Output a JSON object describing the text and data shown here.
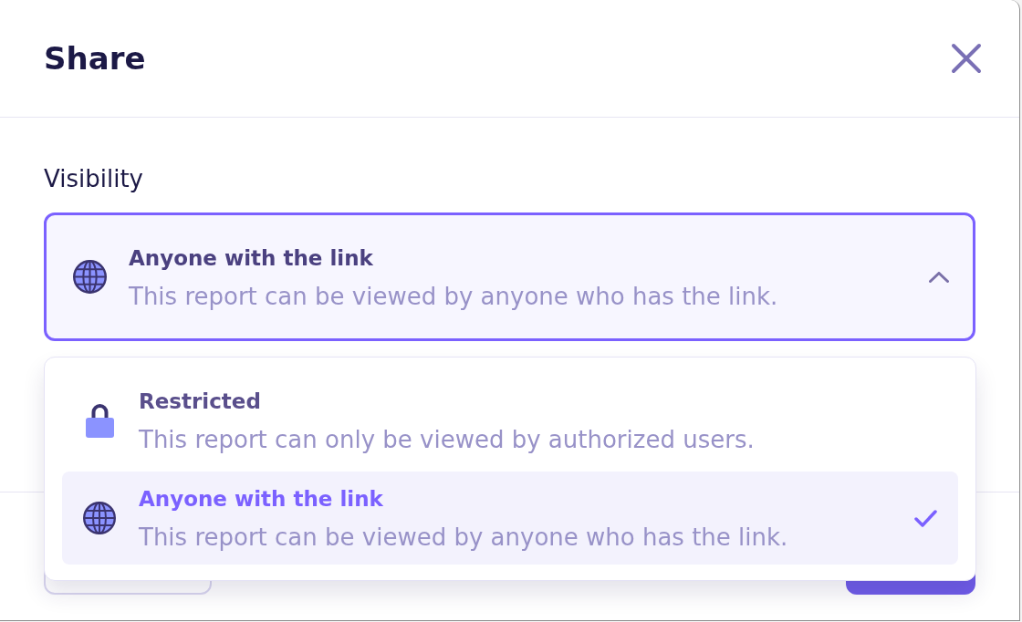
{
  "dialog": {
    "title": "Share"
  },
  "visibility": {
    "label": "Visibility",
    "expanded": true,
    "value": {
      "kind": "globe",
      "title": "Anyone with the link",
      "description": "This report can be viewed by anyone who has the link."
    },
    "options": [
      {
        "kind": "lock",
        "title": "Restricted",
        "description": "This report can only be viewed by authorized users.",
        "selected": false
      },
      {
        "kind": "globe",
        "title": "Anyone with the link",
        "description": "This report can be viewed by anyone who has the link.",
        "selected": true
      }
    ]
  },
  "footer": {
    "buttons": [
      {
        "kind": "secondary"
      },
      {
        "kind": "primary"
      }
    ]
  }
}
